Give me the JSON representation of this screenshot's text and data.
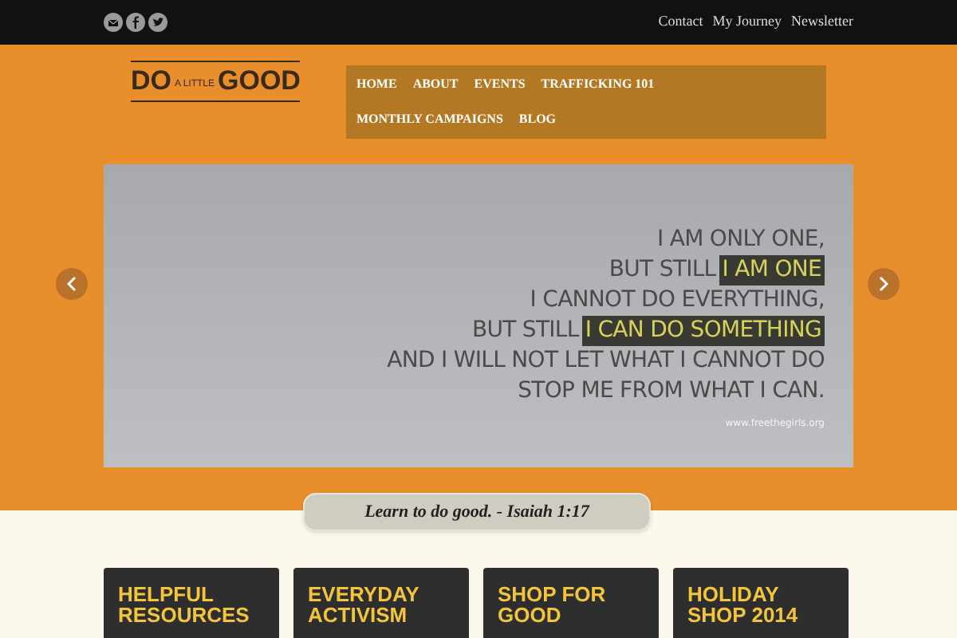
{
  "social_icons": [
    {
      "kind": "email"
    },
    {
      "kind": "facebook"
    },
    {
      "kind": "twitter"
    }
  ],
  "top_links": [
    "Contact",
    "My Journey",
    "Newsletter"
  ],
  "logo": {
    "big_left": "DO",
    "small": "A LITTLE",
    "big_right": "GOOD"
  },
  "nav": [
    "HOME",
    "ABOUT",
    "EVENTS",
    "TRAFFICKING 101",
    "MONTHLY CAMPAIGNS",
    "BLOG"
  ],
  "slide": {
    "lines": [
      {
        "text": "I AM ONLY ONE,"
      },
      {
        "text": "BUT STILL",
        "highlight": "I AM ONE"
      },
      {
        "text": "I CANNOT DO EVERYTHING,"
      },
      {
        "text": "BUT STILL",
        "highlight": "I CAN DO SOMETHING"
      },
      {
        "text": "AND I WILL NOT LET WHAT I CANNOT DO"
      },
      {
        "text": "STOP ME FROM WHAT I CAN."
      }
    ],
    "credit": "www.freethegirls.org"
  },
  "verse": "Learn to do good. - Isaiah 1:17",
  "cards": [
    [
      "HELPFUL",
      "RESOURCES"
    ],
    [
      "EVERYDAY",
      "ACTIVISM"
    ],
    [
      "SHOP FOR",
      "GOOD"
    ],
    [
      "HOLIDAY",
      "SHOP 2014"
    ]
  ]
}
